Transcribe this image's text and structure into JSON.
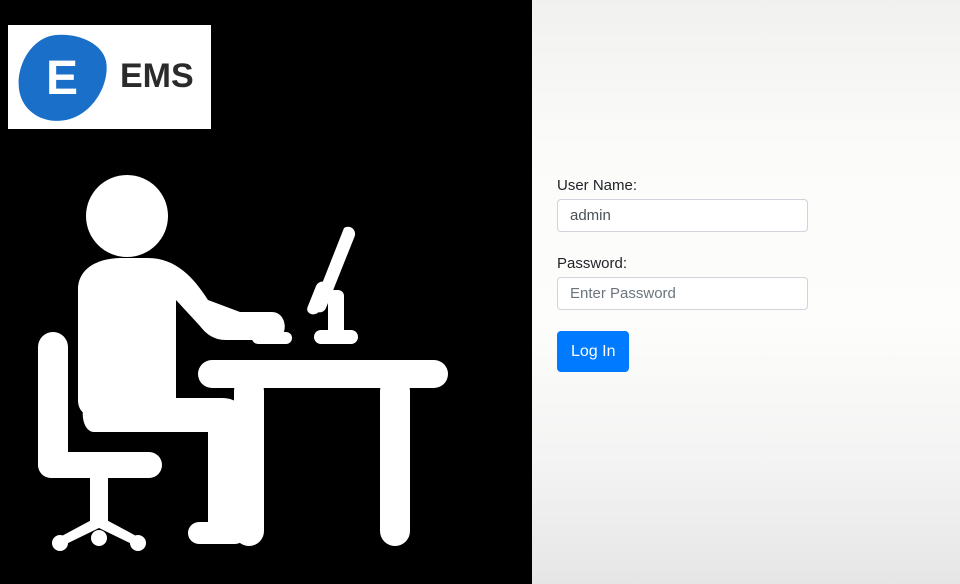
{
  "brand": {
    "logo_letter": "E",
    "logo_text": "EMS",
    "accent": "#1a6fc9"
  },
  "illustration": {
    "icon": "person-at-desk-computer-icon"
  },
  "login": {
    "username_label": "User Name:",
    "username_value": "admin",
    "password_label": "Password:",
    "password_placeholder": "Enter Password",
    "password_value": "",
    "submit_label": "Log In",
    "button_color": "#007bff"
  }
}
